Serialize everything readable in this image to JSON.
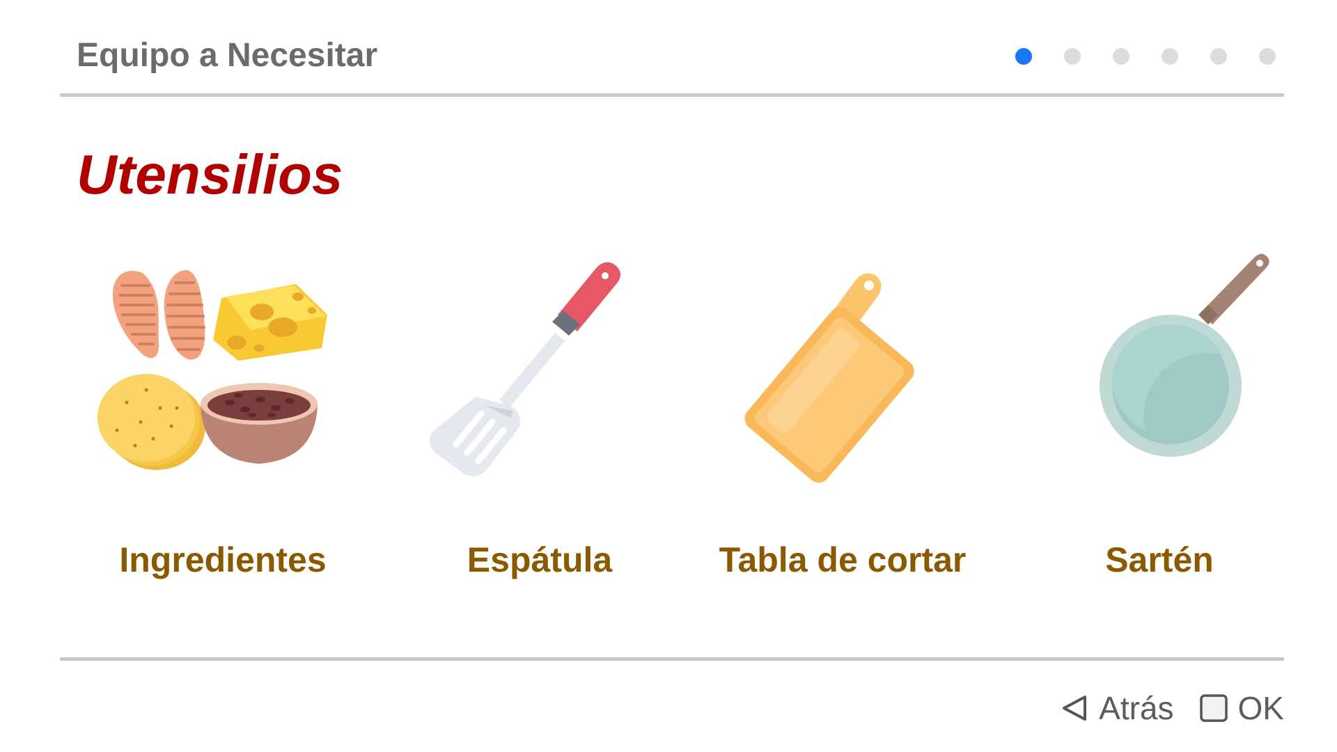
{
  "header": {
    "title": "Equipo a Necesitar",
    "pager": {
      "total": 6,
      "current": 1
    }
  },
  "section": {
    "title": "Utensilios"
  },
  "items": [
    {
      "label": "Ingredientes",
      "icon": "ingredients-icon"
    },
    {
      "label": "Espátula",
      "icon": "spatula-icon"
    },
    {
      "label": "Tabla de cortar",
      "icon": "cutting-board-icon"
    },
    {
      "label": "Sartén",
      "icon": "frying-pan-icon"
    }
  ],
  "footer": {
    "back_label": "Atrás",
    "ok_label": "OK"
  },
  "colors": {
    "accent": "#1877f2",
    "section_title": "#b00000",
    "item_label": "#8b5a00"
  }
}
